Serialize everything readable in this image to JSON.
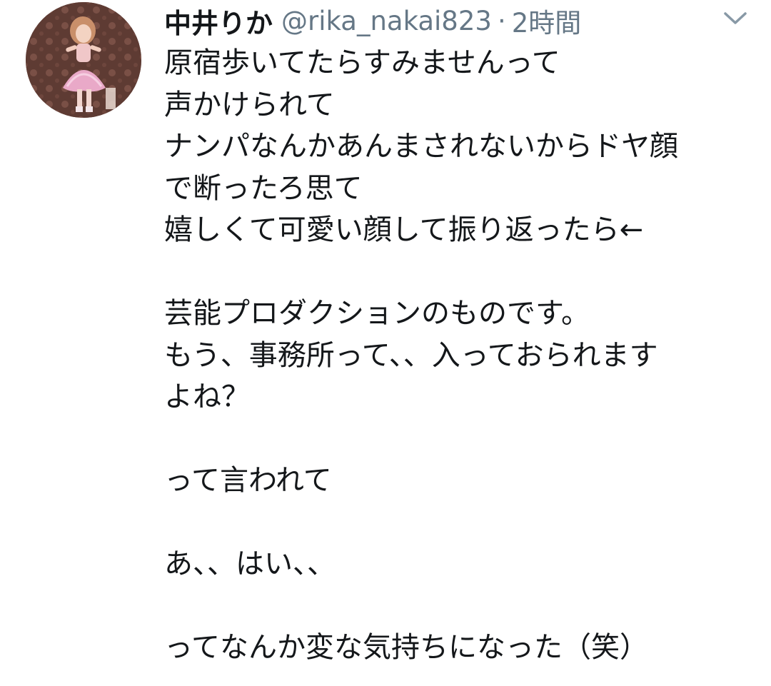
{
  "tweet": {
    "display_name": "中井りか",
    "handle": "@rika_nakai823",
    "separator": "·",
    "time": "2時間",
    "avatar_icon": "avatar-photo",
    "caret_icon": "chevron-down-icon",
    "lines": [
      "原宿歩いてたらすみませんって",
      "声かけられて",
      "ナンパなんかあんまされないからドヤ顔",
      "で断ったろ思て",
      "嬉しくて可愛い顔して振り返ったら←",
      "",
      "芸能プロダクションのものです。",
      "もう、事務所って、、入っておられます",
      "よね？",
      "",
      "って言われて",
      "",
      "あ、、はい、、",
      "",
      "ってなんか変な気持ちになった（笑）"
    ]
  },
  "colors": {
    "text": "#14171a",
    "secondary": "#657786",
    "background": "#ffffff"
  }
}
